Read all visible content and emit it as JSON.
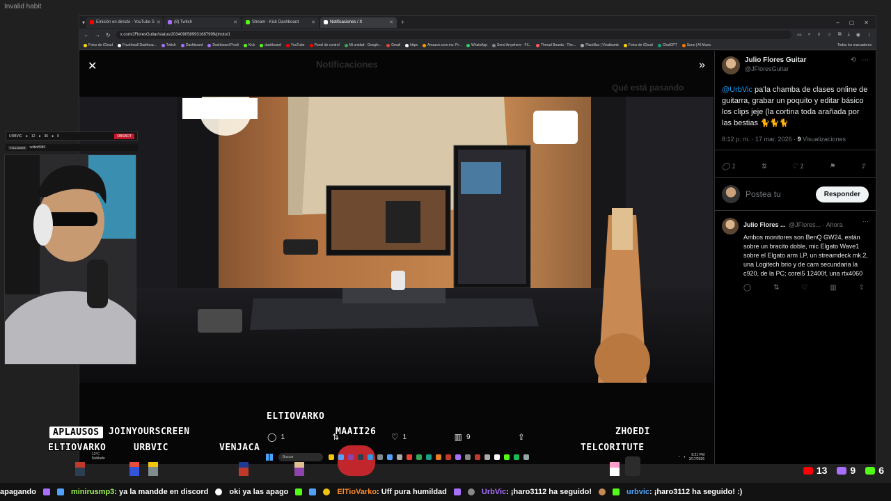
{
  "corner_text": "Invalid habit",
  "browser": {
    "tabs": [
      {
        "label": "Emisión en directo - YouTube S",
        "color": "#ff0000"
      },
      {
        "label": "(8) Twitch",
        "color": "#a970ff"
      },
      {
        "label": "Stream - Kick Dashboard",
        "color": "#53fc18"
      },
      {
        "label": "Notificaciones / X",
        "color": "#ffffff"
      }
    ],
    "url": "x.com/JFloresGuitar/status/2034090589931687999/photo/1",
    "bookmarks": [
      {
        "label": "Fotos de iCloud",
        "color": "#ffd60a"
      },
      {
        "label": "Fourthwall Dashboa...",
        "color": "#ffffff"
      },
      {
        "label": "Twitch",
        "color": "#a970ff"
      },
      {
        "label": "Dashboard",
        "color": "#a970ff"
      },
      {
        "label": "Dashboard Prodi",
        "color": "#a970ff"
      },
      {
        "label": "Kick",
        "color": "#53fc18"
      },
      {
        "label": "dashboard",
        "color": "#53fc18"
      },
      {
        "label": "YouTube",
        "color": "#ff0000"
      },
      {
        "label": "Panel de control",
        "color": "#ff0000"
      },
      {
        "label": "Mi unidad - Google...",
        "color": "#34a853"
      },
      {
        "label": "Gmail",
        "color": "#ea4335"
      },
      {
        "label": "https",
        "color": "#ffffff"
      },
      {
        "label": "Amazon.com.mx: Pr...",
        "color": "#ff9900"
      },
      {
        "label": "WhatsApp",
        "color": "#25d366"
      },
      {
        "label": "Send Anywhere - Fil...",
        "color": "#888888"
      },
      {
        "label": "Thread Boards - The...",
        "color": "#ff5a5a"
      },
      {
        "label": "Plantillas | Vivatbumb",
        "color": "#aaaaaa"
      },
      {
        "label": "Fotos de iCloud",
        "color": "#ffd60a"
      },
      {
        "label": "ChatGPT",
        "color": "#10a37f"
      },
      {
        "label": "Suno | AI Music",
        "color": "#ff7a00"
      }
    ],
    "bookmarks_right": "Todos los marcadores"
  },
  "viewer": {
    "ghost_header": "Notificaciones",
    "ghost_right": "Qué está pasando",
    "actions": {
      "replies": "1",
      "reposts": "",
      "likes": "1",
      "views": "9"
    }
  },
  "tweet": {
    "name": "Julio Flores Guitar",
    "handle": "@JFloresGuitar",
    "mention": "@UrbVic",
    "text": " pa'la chamba de clases online de guitarra, grabar un poquito y editar básico los clips jeje (la cortina toda arañada por las bestias 🐈🐈🐈",
    "time": "8:12 p. m. · 17 mar. 2026 · ",
    "views_count": "9",
    "views_label": " Visualizaciones",
    "replies": "1",
    "likes": "1",
    "reply_placeholder": "Postea tu",
    "reply_button": "Responder"
  },
  "reply": {
    "name": "Julio Flores ...",
    "handle": "@JFlores... · Ahora",
    "text": "Ambos monitores son BenQ GW24, están sobre un bracito doble, mic Elgato Wave1 sobre el Elgato arm LP, un streamdeck mk.2, una Logitech brio y de cam secundaria la c920, de la PC; corei5 12400f, una rtx4060"
  },
  "webcam": {
    "channel": "URBVIC",
    "stat1": "12",
    "stat2": "36",
    "stat3": "0",
    "obs_label": "OBSBOT",
    "follow_pill": "FOLLOWER",
    "follow_user": "voltio8980"
  },
  "overlay_names": {
    "aplausos": "APLAUSOS",
    "joinyourscreen": "JOINYOURSCREEN",
    "eltiovarko_top": "ELTIOVARKO",
    "maaii26": "MAAII26",
    "zhoedi": "ZHOEDI",
    "eltiovarko": "ELTIOVARKO",
    "urbvic": "URBVIC",
    "venjaca": "VENJACA",
    "telcoritute": "TELCORITUTE"
  },
  "taskbar": {
    "search": "Buscar",
    "weather_temp": "12°C",
    "weather_text": "Nublado",
    "time": "8:21 PM",
    "date": "3/17/2026"
  },
  "stats": {
    "youtube": "13",
    "twitch": "9",
    "kick": "6"
  },
  "ticker": [
    {
      "user": "",
      "message": "apagando",
      "tag": ""
    },
    {
      "user": "minirusmp3",
      "message": ": ya la mandde en discord"
    },
    {
      "user": "",
      "message": "oki  ya las apago"
    },
    {
      "user": "ElTioVarko",
      "message": ": Uff pura humildad"
    },
    {
      "user": "UrbVic",
      "message": ": ¡haro3112 ha seguido!"
    },
    {
      "user": "urbvic",
      "message": ": ¡haro3112 ha seguido! :)"
    }
  ]
}
